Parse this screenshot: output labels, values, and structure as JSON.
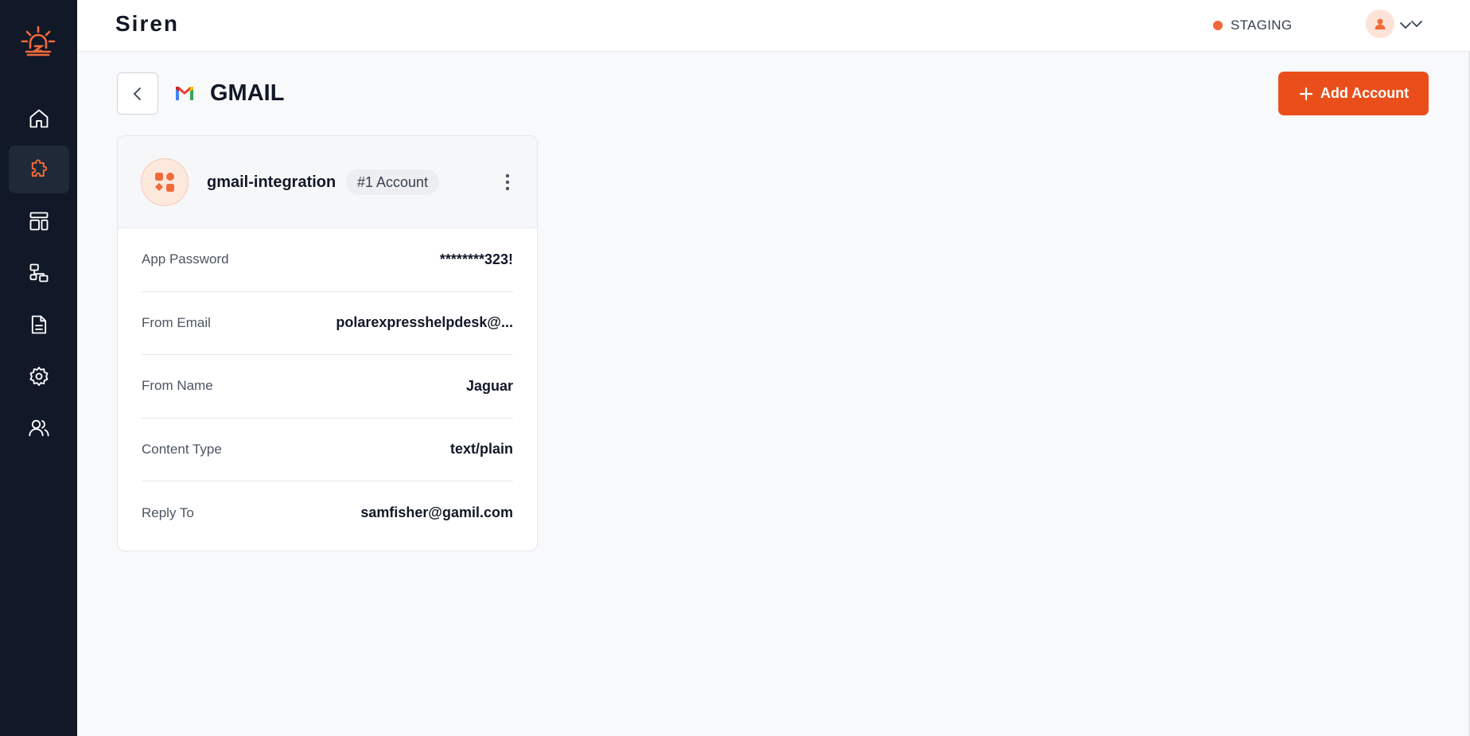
{
  "app": {
    "brand": "Siren"
  },
  "colors": {
    "accent": "#ea4f1b",
    "sidebar": "#111827",
    "env_dot": "#f26a3a"
  },
  "sidebar": {
    "items": [
      {
        "name": "home",
        "icon": "home-icon",
        "active": false
      },
      {
        "name": "integrations",
        "icon": "puzzle-icon",
        "active": true
      },
      {
        "name": "templates",
        "icon": "layout-icon",
        "active": false
      },
      {
        "name": "workflows",
        "icon": "flow-icon",
        "active": false
      },
      {
        "name": "logs",
        "icon": "document-icon",
        "active": false
      },
      {
        "name": "settings",
        "icon": "gear-icon",
        "active": false
      },
      {
        "name": "users",
        "icon": "users-icon",
        "active": false
      }
    ]
  },
  "header": {
    "environment": "STAGING"
  },
  "page": {
    "title": "GMAIL",
    "add_button_label": "Add Account"
  },
  "account_card": {
    "name": "gmail-integration",
    "badge": "#1 Account",
    "fields": [
      {
        "label": "App Password",
        "value": "********323!"
      },
      {
        "label": "From Email",
        "value": "polarexpresshelpdesk@..."
      },
      {
        "label": "From Name",
        "value": "Jaguar"
      },
      {
        "label": "Content Type",
        "value": "text/plain"
      },
      {
        "label": "Reply To",
        "value": "samfisher@gamil.com"
      }
    ]
  }
}
